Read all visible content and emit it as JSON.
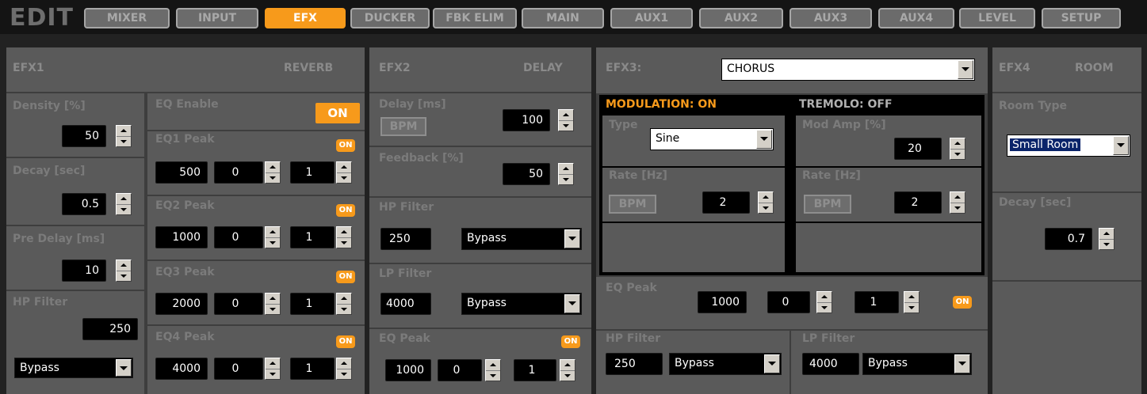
{
  "header": {
    "title": "EDIT",
    "tabs": [
      "MIXER",
      "INPUT",
      "EFX",
      "DUCKER",
      "FBK ELIM",
      "MAIN",
      "AUX1",
      "AUX2",
      "AUX3",
      "AUX4",
      "LEVEL",
      "SETUP"
    ],
    "active_tab": "EFX"
  },
  "efx1": {
    "name": "EFX1",
    "type": "REVERB",
    "density_label": "Density [%]",
    "density_value": "50",
    "decay_label": "Decay [sec]",
    "decay_value": "0.5",
    "predelay_label": "Pre Delay [ms]",
    "predelay_value": "10",
    "hp_label": "HP Filter",
    "hp_value": "250",
    "hp_mode": "Bypass",
    "eq_enable_label": "EQ Enable",
    "eq_enable_state": "ON",
    "eq1_label": "EQ1 Peak",
    "eq1_on": "ON",
    "eq1_freq": "500",
    "eq1_gain": "0",
    "eq1_q": "1",
    "eq2_label": "EQ2 Peak",
    "eq2_on": "ON",
    "eq2_freq": "1000",
    "eq2_gain": "0",
    "eq2_q": "1",
    "eq3_label": "EQ3 Peak",
    "eq3_on": "ON",
    "eq3_freq": "2000",
    "eq3_gain": "0",
    "eq3_q": "1",
    "eq4_label": "EQ4 Peak",
    "eq4_on": "ON",
    "eq4_freq": "4000",
    "eq4_gain": "0",
    "eq4_q": "1"
  },
  "efx2": {
    "name": "EFX2",
    "type": "DELAY",
    "delay_label": "Delay [ms]",
    "delay_value": "100",
    "bpm_label": "BPM",
    "feedback_label": "Feedback [%]",
    "feedback_value": "50",
    "hp_label": "HP Filter",
    "hp_value": "250",
    "hp_mode": "Bypass",
    "lp_label": "LP Filter",
    "lp_value": "4000",
    "lp_mode": "Bypass",
    "eq_label": "EQ Peak",
    "eq_on": "ON",
    "eq_freq": "1000",
    "eq_gain": "0",
    "eq_q": "1"
  },
  "efx3": {
    "name": "EFX3:",
    "type_select": "CHORUS",
    "mod_header": "MODULATION: ON",
    "mod_type_label": "Type",
    "mod_type_value": "Sine",
    "mod_rate_label": "Rate [Hz]",
    "mod_bpm": "BPM",
    "mod_rate_value": "2",
    "trem_header": "TREMOLO: OFF",
    "trem_amp_label": "Mod Amp [%]",
    "trem_amp_value": "20",
    "trem_rate_label": "Rate [Hz]",
    "trem_bpm": "BPM",
    "trem_rate_value": "2",
    "eq_label": "EQ Peak",
    "eq_freq": "1000",
    "eq_gain": "0",
    "eq_q": "1",
    "eq_on": "ON",
    "hp_label": "HP Filter",
    "hp_value": "250",
    "hp_mode": "Bypass",
    "lp_label": "LP Filter",
    "lp_value": "4000",
    "lp_mode": "Bypass"
  },
  "efx4": {
    "name": "EFX4",
    "type": "ROOM",
    "room_type_label": "Room Type",
    "room_type_value": "Small Room",
    "decay_label": "Decay [sec]",
    "decay_value": "0.7"
  },
  "colors": {
    "accent": "#f79a1b",
    "panel": "#5a5a5a",
    "background": "#222222",
    "mod_header": "#f79a1b",
    "trem_header": "#b0b0b0"
  }
}
